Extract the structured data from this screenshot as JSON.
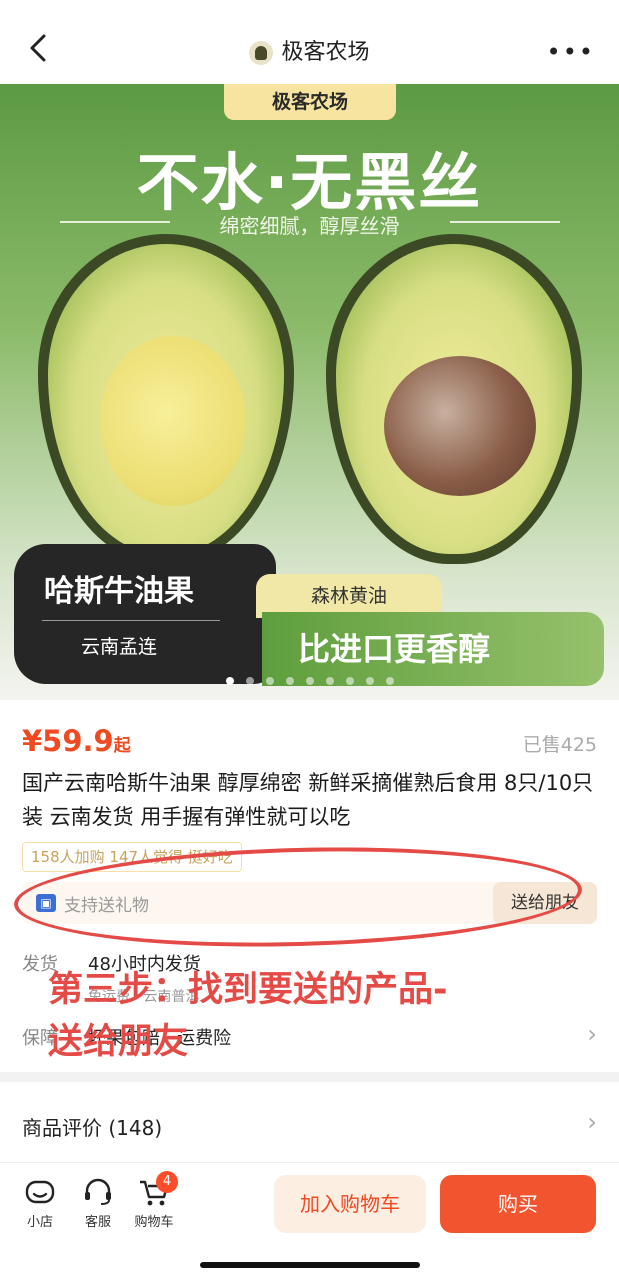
{
  "header": {
    "title": "极客农场"
  },
  "hero": {
    "brand": "极客农场",
    "headline": "不水·无黑丝",
    "subline": "绵密细腻，醇厚丝滑",
    "badge_title": "哈斯牛油果",
    "badge_sub": "云南孟连",
    "tab_label": "森林黄油",
    "band_text": "比进口更香醇"
  },
  "product": {
    "price": "¥59.9",
    "price_suffix": "起",
    "sold": "已售425",
    "title": "国产云南哈斯牛油果 醇厚绵密 新鲜采摘催熟后食用 8只/10只装 云南发货 用手握有弹性就可以吃",
    "tags": "158人加购 147人觉得 挺好吃",
    "gift_text": "支持送礼物",
    "gift_button": "送给朋友"
  },
  "shipping": {
    "label": "发货",
    "value": "48小时内发货",
    "sub": "免运费 · 云南普洱"
  },
  "guarantee": {
    "label": "保障",
    "value": "坏果包赔 · 运费险"
  },
  "annotation": {
    "line1": "第三步：找到要送的产品-",
    "line2": "送给朋友"
  },
  "reviews": {
    "label": "商品评价 (148)"
  },
  "bottom_bar": {
    "shop": "小店",
    "service": "客服",
    "cart": "购物车",
    "cart_count": "4",
    "add_to_cart": "加入购物车",
    "buy": "购买"
  },
  "colors": {
    "accent": "#ef4a21",
    "annotation": "#e44a46",
    "hero_green": "#5c9a43"
  },
  "carousel": {
    "total_dots": 9,
    "active_index": 0
  }
}
